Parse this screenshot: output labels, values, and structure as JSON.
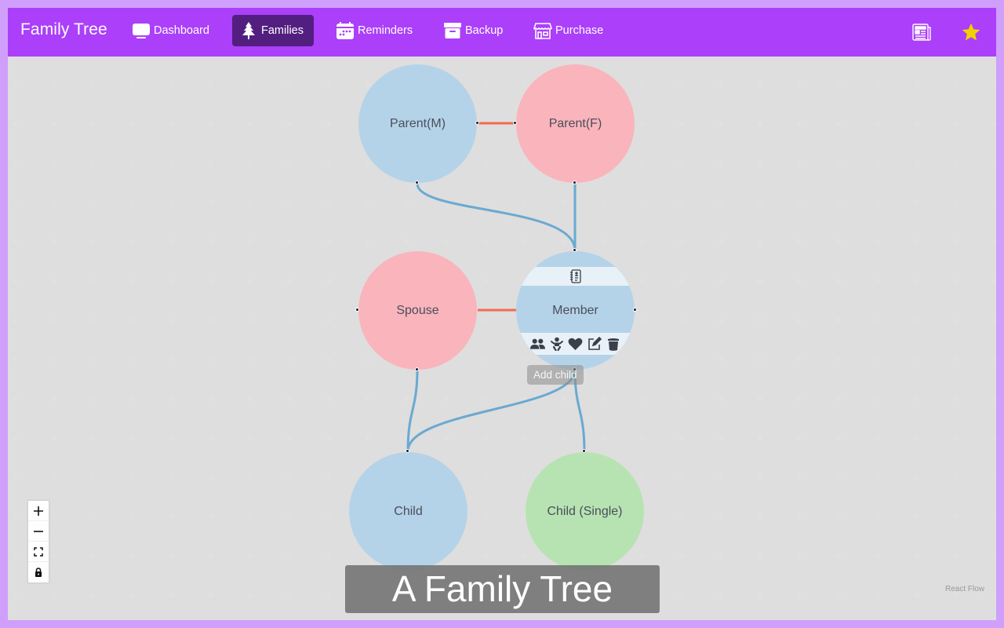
{
  "app": {
    "title": "Family Tree"
  },
  "nav": {
    "items": [
      {
        "label": "Dashboard",
        "icon": "monitor-icon",
        "active": false
      },
      {
        "label": "Families",
        "icon": "tree-icon",
        "active": true
      },
      {
        "label": "Reminders",
        "icon": "calendar-icon",
        "active": false
      },
      {
        "label": "Backup",
        "icon": "archive-box-icon",
        "active": false
      },
      {
        "label": "Purchase",
        "icon": "store-icon",
        "active": false
      }
    ],
    "right_icons": [
      "newspaper-icon",
      "star-icon"
    ]
  },
  "colors": {
    "navbar": "#ab3ffa",
    "nav_active": "#521f80",
    "frame": "#cf9ffb",
    "male_node": "#b5d3e8",
    "female_node": "#fab4bc",
    "single_child_node": "#b7e3b2",
    "spouse_edge": "#f26b4e",
    "child_edge": "#6aa9d2",
    "star": "#f0d000"
  },
  "nodes": [
    {
      "id": "parent-m",
      "label": "Parent(M)",
      "kind": "male"
    },
    {
      "id": "parent-f",
      "label": "Parent(F)",
      "kind": "female"
    },
    {
      "id": "spouse",
      "label": "Spouse",
      "kind": "female"
    },
    {
      "id": "member",
      "label": "Member",
      "kind": "male",
      "selected": true
    },
    {
      "id": "child",
      "label": "Child",
      "kind": "male"
    },
    {
      "id": "child-single",
      "label": "Child (Single)",
      "kind": "single"
    }
  ],
  "member_actions": {
    "top": [
      "notebook-icon"
    ],
    "bottom": [
      "users-icon",
      "baby-icon",
      "heart-icon",
      "edit-icon",
      "trash-icon"
    ],
    "tooltip": "Add child"
  },
  "controls": {
    "zoom_in": "+",
    "zoom_out": "−",
    "fit_view": "fit-view",
    "lock": "lock"
  },
  "attribution": "React Flow",
  "caption": "A Family Tree"
}
